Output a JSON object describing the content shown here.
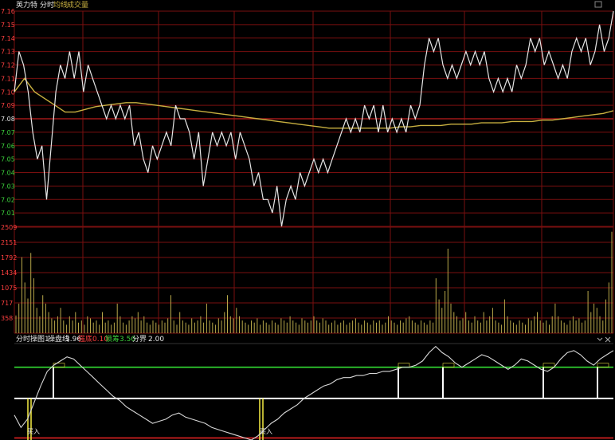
{
  "header": {
    "stock_name": "英力特",
    "mode": "分时",
    "avg_line_label": "均线",
    "volume_label": "成交量"
  },
  "indicator_header": {
    "name": "分时操图1",
    "ops_line_label": "操盘线",
    "ops_line_value": "3.96",
    "strong_label": "强底",
    "strong_value": "0.10",
    "lock_label": "锁筹",
    "lock_value": "3.50",
    "boundary_label": "分界",
    "boundary_value": "2.00"
  },
  "buy_label": "买入",
  "colors": {
    "price_line": "#e6e6e6",
    "avg_line": "#c8b040",
    "grid": "#7a0f0f",
    "up_text": "#ff4040",
    "down_text": "#3cd23c",
    "baseline_text": "#e6e6e6",
    "volume_bar": "#b8a84a",
    "green_level": "#33dd33",
    "white_level": "#ffffff",
    "red_level": "#dd2222",
    "buy_marker": "#e8e040"
  },
  "chart_data": [
    {
      "type": "line",
      "title": "英力特 分时",
      "ylim": [
        7.0,
        7.16
      ],
      "baseline": 7.08,
      "y_ticks": [
        "7.16",
        "7.15",
        "7.14",
        "7.13",
        "7.12",
        "7.11",
        "7.10",
        "7.09",
        "7.08",
        "7.07",
        "7.06",
        "7.05",
        "7.04",
        "7.03",
        "7.02",
        "7.01"
      ],
      "series": [
        {
          "name": "分时",
          "values": [
            7.1,
            7.13,
            7.12,
            7.1,
            7.07,
            7.05,
            7.06,
            7.02,
            7.06,
            7.1,
            7.12,
            7.11,
            7.13,
            7.11,
            7.13,
            7.1,
            7.12,
            7.11,
            7.1,
            7.09,
            7.08,
            7.09,
            7.08,
            7.09,
            7.08,
            7.09,
            7.06,
            7.07,
            7.05,
            7.04,
            7.06,
            7.05,
            7.06,
            7.07,
            7.06,
            7.09,
            7.08,
            7.08,
            7.07,
            7.05,
            7.07,
            7.03,
            7.05,
            7.07,
            7.06,
            7.07,
            7.06,
            7.07,
            7.05,
            7.07,
            7.06,
            7.05,
            7.03,
            7.04,
            7.02,
            7.02,
            7.01,
            7.03,
            7.0,
            7.02,
            7.03,
            7.02,
            7.04,
            7.03,
            7.04,
            7.05,
            7.04,
            7.05,
            7.04,
            7.05,
            7.06,
            7.07,
            7.08,
            7.07,
            7.08,
            7.07,
            7.09,
            7.08,
            7.09,
            7.07,
            7.09,
            7.07,
            7.08,
            7.07,
            7.08,
            7.07,
            7.09,
            7.08,
            7.09,
            7.12,
            7.14,
            7.13,
            7.14,
            7.12,
            7.11,
            7.12,
            7.11,
            7.12,
            7.13,
            7.12,
            7.13,
            7.12,
            7.13,
            7.11,
            7.1,
            7.11,
            7.1,
            7.11,
            7.1,
            7.12,
            7.11,
            7.12,
            7.14,
            7.13,
            7.14,
            7.12,
            7.13,
            7.12,
            7.11,
            7.12,
            7.11,
            7.13,
            7.14,
            7.13,
            7.14,
            7.12,
            7.13,
            7.15,
            7.13,
            7.14,
            7.16
          ]
        },
        {
          "name": "均线",
          "values": [
            7.1,
            7.11,
            7.1,
            7.095,
            7.09,
            7.085,
            7.085,
            7.087,
            7.089,
            7.09,
            7.091,
            7.092,
            7.092,
            7.091,
            7.09,
            7.089,
            7.088,
            7.087,
            7.086,
            7.085,
            7.084,
            7.083,
            7.082,
            7.081,
            7.08,
            7.079,
            7.078,
            7.077,
            7.076,
            7.075,
            7.074,
            7.073,
            7.073,
            7.073,
            7.073,
            7.073,
            7.073,
            7.073,
            7.074,
            7.074,
            7.075,
            7.075,
            7.075,
            7.076,
            7.076,
            7.076,
            7.077,
            7.077,
            7.077,
            7.078,
            7.078,
            7.078,
            7.079,
            7.079,
            7.08,
            7.081,
            7.082,
            7.083,
            7.084,
            7.086
          ]
        }
      ]
    },
    {
      "type": "bar",
      "title": "成交量",
      "ylim": [
        0,
        2509
      ],
      "y_ticks": [
        "2509",
        "2151",
        "1792",
        "1434",
        "1075",
        "717",
        "358"
      ],
      "values": [
        420,
        700,
        1800,
        1200,
        820,
        1900,
        1300,
        600,
        400,
        900,
        700,
        500,
        350,
        300,
        400,
        600,
        300,
        200,
        400,
        300,
        500,
        250,
        300,
        200,
        400,
        350,
        250,
        300,
        200,
        500,
        250,
        300,
        200,
        250,
        700,
        400,
        250,
        200,
        300,
        400,
        350,
        500,
        300,
        400,
        250,
        200,
        300,
        250,
        200,
        300,
        250,
        350,
        900,
        300,
        200,
        500,
        300,
        250,
        200,
        350,
        250,
        300,
        400,
        250,
        700,
        300,
        250,
        200,
        350,
        300,
        500,
        900,
        400,
        350,
        600,
        400,
        300,
        250,
        200,
        300,
        250,
        350,
        200,
        300,
        250,
        200,
        300,
        250,
        200,
        350,
        300,
        250,
        400,
        300,
        250,
        200,
        350,
        300,
        250,
        300,
        400,
        300,
        250,
        350,
        300,
        200,
        250,
        300,
        200,
        250,
        300,
        200,
        250,
        300,
        350,
        250,
        200,
        300,
        250,
        200,
        300,
        250,
        300,
        200,
        250,
        400,
        300,
        250,
        200,
        300,
        250,
        350,
        400,
        300,
        250,
        200,
        300,
        250,
        200,
        300,
        250,
        1300,
        800,
        600,
        1000,
        2000,
        700,
        500,
        400,
        300,
        350,
        500,
        300,
        250,
        400,
        300,
        250,
        500,
        300,
        400,
        600,
        300,
        250,
        200,
        800,
        400,
        300,
        250,
        200,
        300,
        250,
        200,
        350,
        300,
        400,
        500,
        300,
        250,
        300,
        200,
        400,
        700,
        400,
        300,
        250,
        200,
        300,
        400,
        300,
        350,
        250,
        300,
        1000,
        500,
        700,
        600,
        400,
        300,
        800,
        1200,
        2400
      ]
    },
    {
      "type": "line",
      "title": "分时操图1",
      "ylim": [
        0,
        4.6
      ],
      "levels": {
        "操盘线": 3.96,
        "强底": 0.1,
        "锁筹": 3.5,
        "分界": 2.0
      },
      "series": [
        {
          "name": "操盘线",
          "values": [
            1.2,
            0.6,
            1.0,
            1.8,
            2.6,
            3.3,
            3.6,
            3.8,
            4.0,
            3.9,
            3.6,
            3.3,
            3.0,
            2.7,
            2.4,
            2.1,
            1.9,
            1.6,
            1.4,
            1.2,
            1.0,
            0.8,
            0.9,
            1.0,
            1.2,
            1.3,
            1.1,
            1.0,
            0.9,
            0.8,
            0.6,
            0.5,
            0.4,
            0.3,
            0.2,
            0.1,
            0.0,
            0.2,
            0.5,
            0.8,
            1.0,
            1.3,
            1.5,
            1.7,
            2.0,
            2.2,
            2.4,
            2.6,
            2.7,
            2.9,
            3.0,
            3.0,
            3.1,
            3.1,
            3.2,
            3.2,
            3.3,
            3.3,
            3.4,
            3.5,
            3.5,
            3.6,
            3.8,
            4.2,
            4.5,
            4.2,
            4.0,
            3.7,
            3.5,
            3.7,
            3.9,
            4.1,
            4.0,
            3.8,
            3.6,
            3.4,
            3.6,
            3.9,
            3.8,
            3.6,
            3.4,
            3.3,
            3.5,
            3.9,
            4.2,
            4.3,
            4.1,
            3.8,
            3.6,
            3.9,
            4.1,
            4.3
          ]
        }
      ]
    }
  ]
}
